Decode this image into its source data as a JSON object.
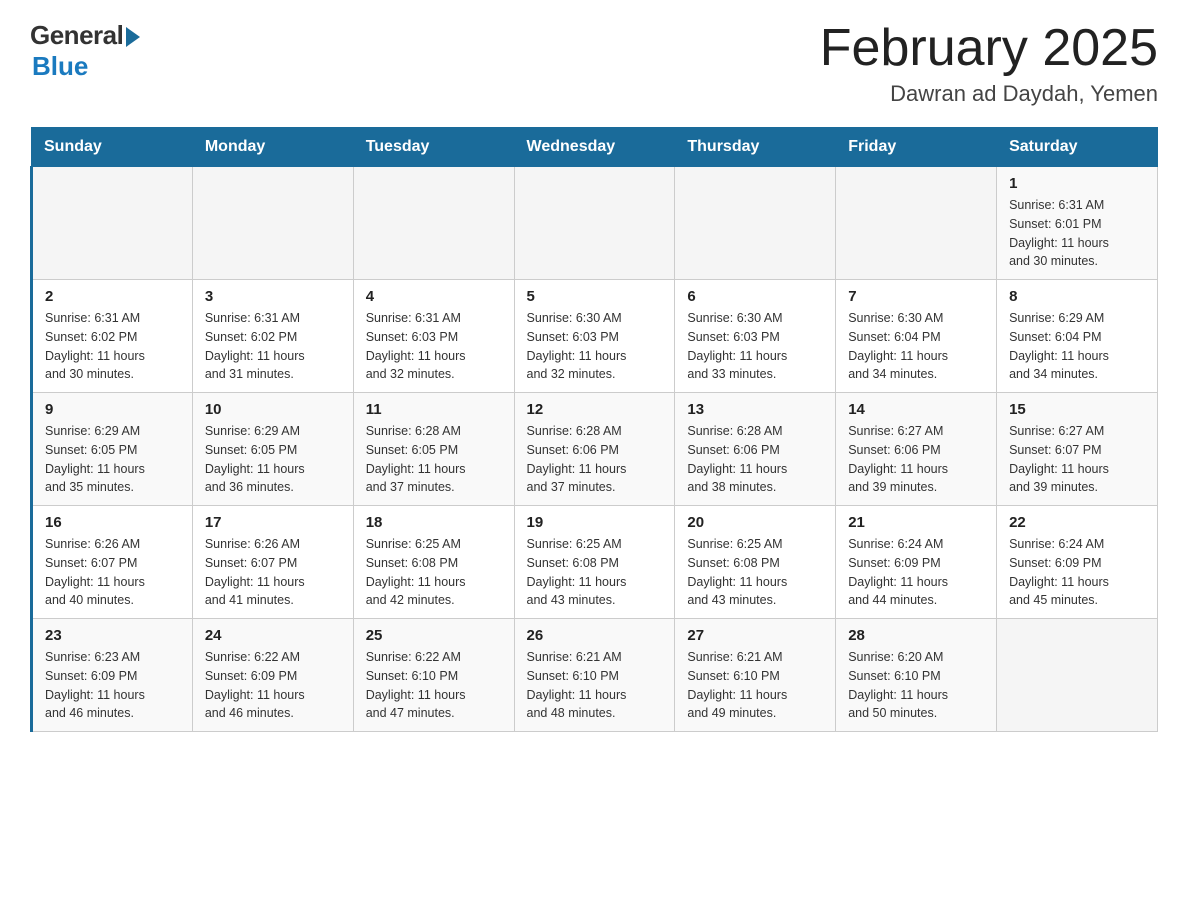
{
  "logo": {
    "general": "General",
    "blue": "Blue"
  },
  "title": "February 2025",
  "location": "Dawran ad Daydah, Yemen",
  "headers": [
    "Sunday",
    "Monday",
    "Tuesday",
    "Wednesday",
    "Thursday",
    "Friday",
    "Saturday"
  ],
  "weeks": [
    [
      {
        "day": "",
        "info": ""
      },
      {
        "day": "",
        "info": ""
      },
      {
        "day": "",
        "info": ""
      },
      {
        "day": "",
        "info": ""
      },
      {
        "day": "",
        "info": ""
      },
      {
        "day": "",
        "info": ""
      },
      {
        "day": "1",
        "info": "Sunrise: 6:31 AM\nSunset: 6:01 PM\nDaylight: 11 hours\nand 30 minutes."
      }
    ],
    [
      {
        "day": "2",
        "info": "Sunrise: 6:31 AM\nSunset: 6:02 PM\nDaylight: 11 hours\nand 30 minutes."
      },
      {
        "day": "3",
        "info": "Sunrise: 6:31 AM\nSunset: 6:02 PM\nDaylight: 11 hours\nand 31 minutes."
      },
      {
        "day": "4",
        "info": "Sunrise: 6:31 AM\nSunset: 6:03 PM\nDaylight: 11 hours\nand 32 minutes."
      },
      {
        "day": "5",
        "info": "Sunrise: 6:30 AM\nSunset: 6:03 PM\nDaylight: 11 hours\nand 32 minutes."
      },
      {
        "day": "6",
        "info": "Sunrise: 6:30 AM\nSunset: 6:03 PM\nDaylight: 11 hours\nand 33 minutes."
      },
      {
        "day": "7",
        "info": "Sunrise: 6:30 AM\nSunset: 6:04 PM\nDaylight: 11 hours\nand 34 minutes."
      },
      {
        "day": "8",
        "info": "Sunrise: 6:29 AM\nSunset: 6:04 PM\nDaylight: 11 hours\nand 34 minutes."
      }
    ],
    [
      {
        "day": "9",
        "info": "Sunrise: 6:29 AM\nSunset: 6:05 PM\nDaylight: 11 hours\nand 35 minutes."
      },
      {
        "day": "10",
        "info": "Sunrise: 6:29 AM\nSunset: 6:05 PM\nDaylight: 11 hours\nand 36 minutes."
      },
      {
        "day": "11",
        "info": "Sunrise: 6:28 AM\nSunset: 6:05 PM\nDaylight: 11 hours\nand 37 minutes."
      },
      {
        "day": "12",
        "info": "Sunrise: 6:28 AM\nSunset: 6:06 PM\nDaylight: 11 hours\nand 37 minutes."
      },
      {
        "day": "13",
        "info": "Sunrise: 6:28 AM\nSunset: 6:06 PM\nDaylight: 11 hours\nand 38 minutes."
      },
      {
        "day": "14",
        "info": "Sunrise: 6:27 AM\nSunset: 6:06 PM\nDaylight: 11 hours\nand 39 minutes."
      },
      {
        "day": "15",
        "info": "Sunrise: 6:27 AM\nSunset: 6:07 PM\nDaylight: 11 hours\nand 39 minutes."
      }
    ],
    [
      {
        "day": "16",
        "info": "Sunrise: 6:26 AM\nSunset: 6:07 PM\nDaylight: 11 hours\nand 40 minutes."
      },
      {
        "day": "17",
        "info": "Sunrise: 6:26 AM\nSunset: 6:07 PM\nDaylight: 11 hours\nand 41 minutes."
      },
      {
        "day": "18",
        "info": "Sunrise: 6:25 AM\nSunset: 6:08 PM\nDaylight: 11 hours\nand 42 minutes."
      },
      {
        "day": "19",
        "info": "Sunrise: 6:25 AM\nSunset: 6:08 PM\nDaylight: 11 hours\nand 43 minutes."
      },
      {
        "day": "20",
        "info": "Sunrise: 6:25 AM\nSunset: 6:08 PM\nDaylight: 11 hours\nand 43 minutes."
      },
      {
        "day": "21",
        "info": "Sunrise: 6:24 AM\nSunset: 6:09 PM\nDaylight: 11 hours\nand 44 minutes."
      },
      {
        "day": "22",
        "info": "Sunrise: 6:24 AM\nSunset: 6:09 PM\nDaylight: 11 hours\nand 45 minutes."
      }
    ],
    [
      {
        "day": "23",
        "info": "Sunrise: 6:23 AM\nSunset: 6:09 PM\nDaylight: 11 hours\nand 46 minutes."
      },
      {
        "day": "24",
        "info": "Sunrise: 6:22 AM\nSunset: 6:09 PM\nDaylight: 11 hours\nand 46 minutes."
      },
      {
        "day": "25",
        "info": "Sunrise: 6:22 AM\nSunset: 6:10 PM\nDaylight: 11 hours\nand 47 minutes."
      },
      {
        "day": "26",
        "info": "Sunrise: 6:21 AM\nSunset: 6:10 PM\nDaylight: 11 hours\nand 48 minutes."
      },
      {
        "day": "27",
        "info": "Sunrise: 6:21 AM\nSunset: 6:10 PM\nDaylight: 11 hours\nand 49 minutes."
      },
      {
        "day": "28",
        "info": "Sunrise: 6:20 AM\nSunset: 6:10 PM\nDaylight: 11 hours\nand 50 minutes."
      },
      {
        "day": "",
        "info": ""
      }
    ]
  ]
}
